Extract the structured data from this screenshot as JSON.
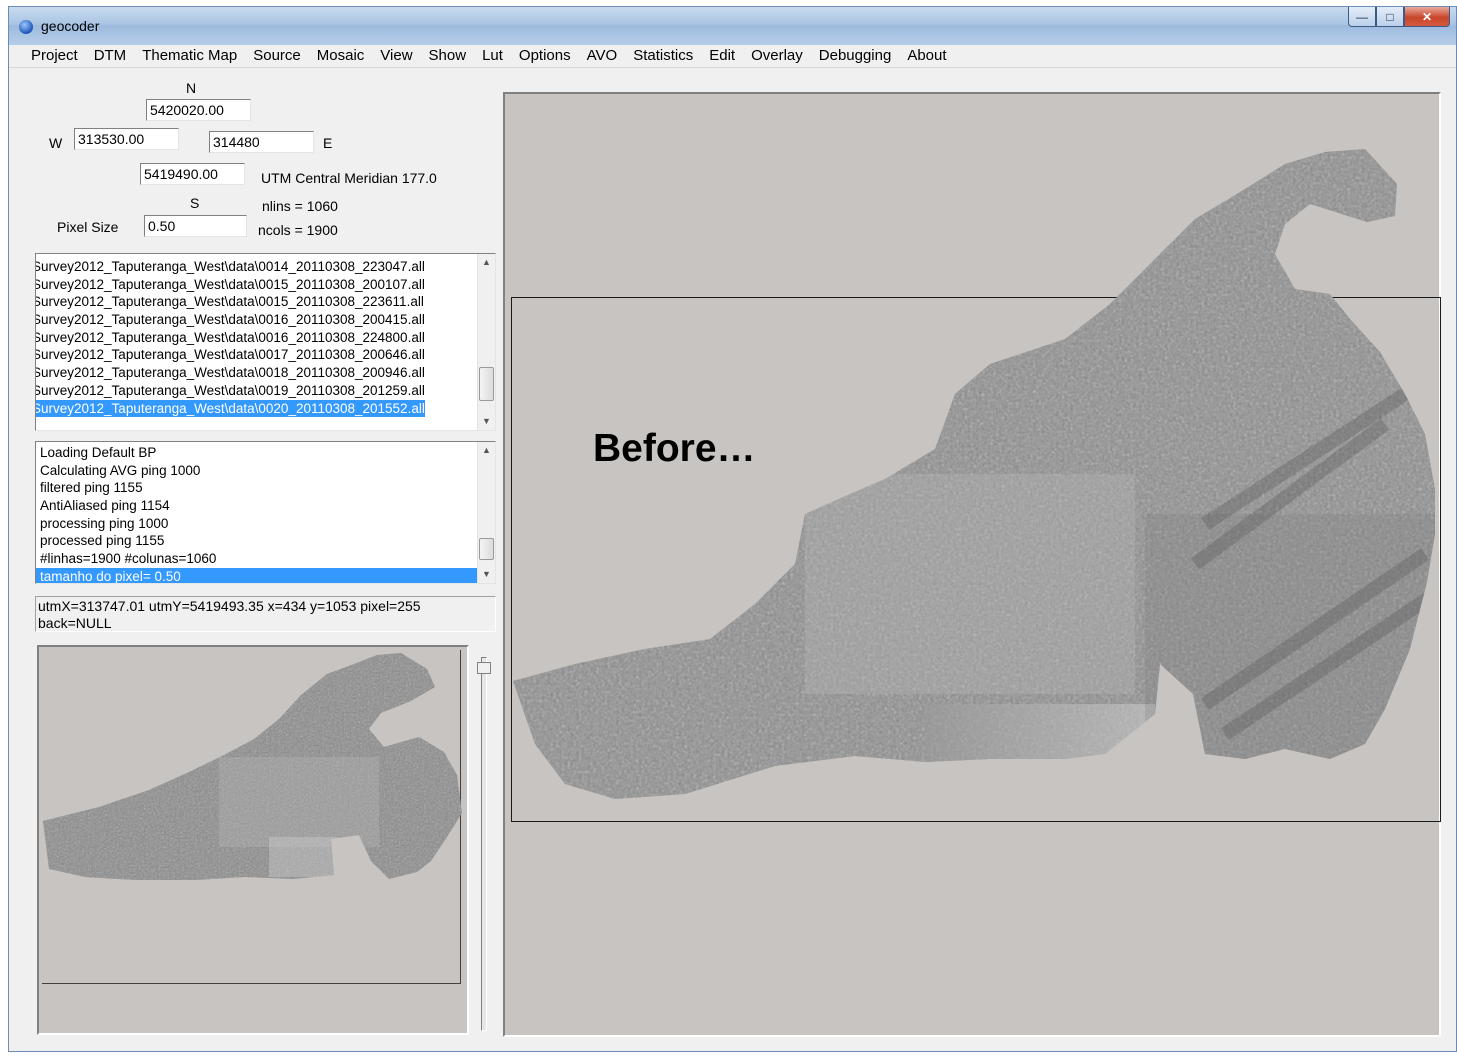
{
  "window": {
    "title": "geocoder"
  },
  "menu": [
    "Project",
    "DTM",
    "Thematic Map",
    "Source",
    "Mosaic",
    "View",
    "Show",
    "Lut",
    "Options",
    "AVO",
    "Statistics",
    "Edit",
    "Overlay",
    "Debugging",
    "About"
  ],
  "coords": {
    "n_label": "N",
    "n_value": "5420020.00",
    "w_label": "W",
    "w_value": "313530.00",
    "e_value": "314480",
    "e_label": "E",
    "s_value": "5419490.00",
    "s_label": "S",
    "utm_text": "UTM Central Meridian 177.0",
    "nlins": "nlins = 1060",
    "pixel_size_label": "Pixel Size",
    "pixel_size_value": "0.50",
    "ncols": "ncols = 1900"
  },
  "files": [
    "Survey2012_Taputeranga_West\\data\\0014_20110308_223047.all",
    "Survey2012_Taputeranga_West\\data\\0015_20110308_200107.all",
    "Survey2012_Taputeranga_West\\data\\0015_20110308_223611.all",
    "Survey2012_Taputeranga_West\\data\\0016_20110308_200415.all",
    "Survey2012_Taputeranga_West\\data\\0016_20110308_224800.all",
    "Survey2012_Taputeranga_West\\data\\0017_20110308_200646.all",
    "Survey2012_Taputeranga_West\\data\\0018_20110308_200946.all",
    "Survey2012_Taputeranga_West\\data\\0019_20110308_201259.all",
    "Survey2012_Taputeranga_West\\data\\0020_20110308_201552.all"
  ],
  "log": [
    "Loading Default BP",
    "Calculating AVG ping 1000",
    "filtered ping 1155",
    "AntiAliased ping 1154",
    "processing ping 1000",
    "processed ping 1155",
    "#linhas=1900 #colunas=1060",
    "tamanho do pixel= 0.50"
  ],
  "status": {
    "line1": "utmX=313747.01 utmY=5419493.35 x=434 y=1053 pixel=255",
    "line2": "back=NULL"
  },
  "annotation": "Before…",
  "icons": {
    "app": "globe-icon",
    "minimize": "minimize-icon",
    "maximize": "maximize-icon",
    "close": "close-icon"
  }
}
